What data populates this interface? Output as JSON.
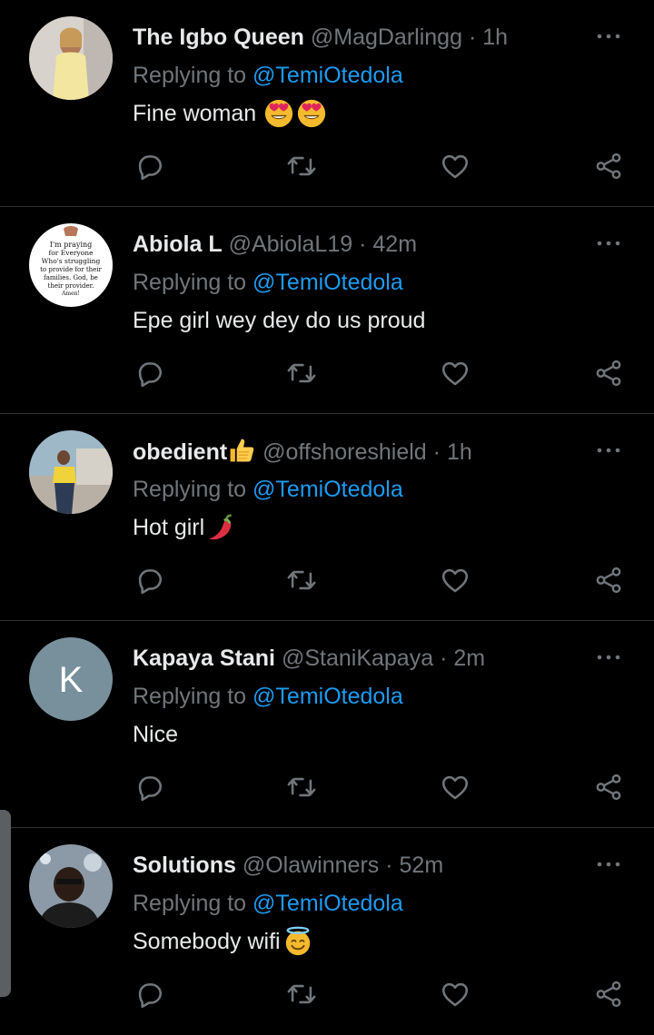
{
  "colors": {
    "background": "#000000",
    "primary_text": "#e7e9ea",
    "secondary_text": "#71767b",
    "mention": "#1d9bf0",
    "divider": "#2f3336"
  },
  "tweets": [
    {
      "name": "The Igbo Queen",
      "handle": "@MagDarlingg",
      "separator": "·",
      "time": "1h",
      "replying_prefix": "Replying to",
      "replying_to": "@TemiOtedola",
      "text": "Fine woman",
      "emoji": [
        "heart-eyes",
        "heart-eyes"
      ]
    },
    {
      "name": "Abiola L",
      "handle": "@AbiolaL19",
      "separator": "·",
      "time": "42m",
      "replying_prefix": "Replying to",
      "replying_to": "@TemiOtedola",
      "text": "Epe girl wey dey do us proud",
      "avatar_text": [
        "I'm praying",
        "for Everyone",
        "Who's struggling",
        "to provide for their",
        "families. God, be",
        "their provider.",
        "Amen!"
      ]
    },
    {
      "name": "obedient",
      "name_emoji": "thumbs-up",
      "handle": "@offshoreshield",
      "separator": "·",
      "time": "1h",
      "replying_prefix": "Replying to",
      "replying_to": "@TemiOtedola",
      "text": "Hot girl",
      "emoji": [
        "hot-pepper"
      ]
    },
    {
      "name": "Kapaya Stani",
      "handle": "@StaniKapaya",
      "separator": "·",
      "time": "2m",
      "replying_prefix": "Replying to",
      "replying_to": "@TemiOtedola",
      "text": "Nice",
      "avatar_letter": "K"
    },
    {
      "name": "Solutions",
      "handle": "@Olawinners",
      "separator": "·",
      "time": "52m",
      "replying_prefix": "Replying to",
      "replying_to": "@TemiOtedola",
      "text": "Somebody wifi",
      "emoji": [
        "halo-smile"
      ]
    }
  ]
}
